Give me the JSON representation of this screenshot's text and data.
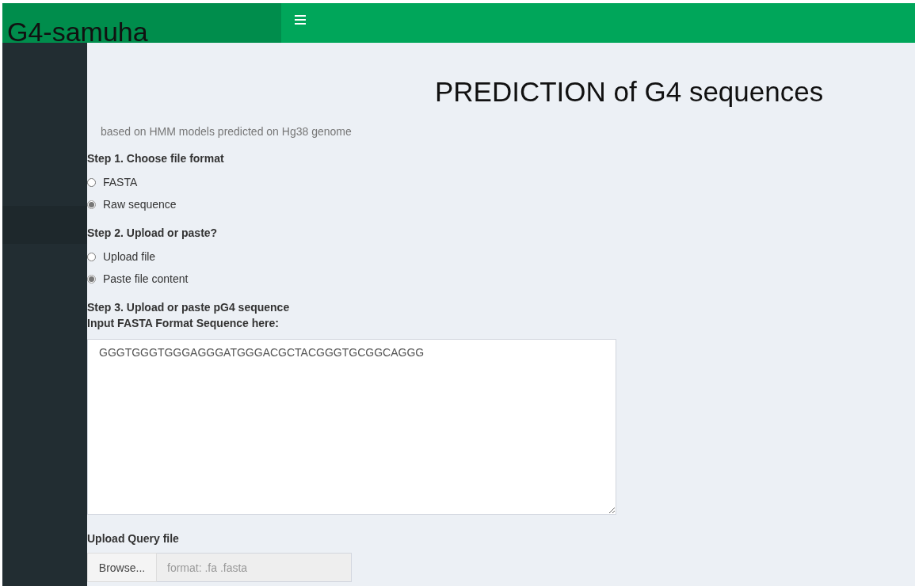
{
  "header": {
    "logo": "G4-samuha"
  },
  "page": {
    "title": "PREDICTION of G4 sequences",
    "subtitle": "based on HMM models predicted on Hg38 genome"
  },
  "steps": [
    {
      "label": "Step 1. Choose file format",
      "options": [
        {
          "label": "FASTA",
          "selected": false
        },
        {
          "label": "Raw sequence",
          "selected": true
        }
      ]
    },
    {
      "label": "Step 2. Upload or paste?",
      "options": [
        {
          "label": "Upload file",
          "selected": false
        },
        {
          "label": "Paste file content",
          "selected": true
        }
      ]
    }
  ],
  "sequence_input": {
    "step_label": "Step 3. Upload or paste pG4 sequence",
    "label": "Input FASTA Format Sequence here:",
    "value": "GGGTGGGTGGGAGGGATGGGACGCTACGGGTGCGGCAGGG"
  },
  "file_upload": {
    "label": "Upload Query file",
    "button": "Browse...",
    "placeholder": "format: .fa .fasta"
  }
}
